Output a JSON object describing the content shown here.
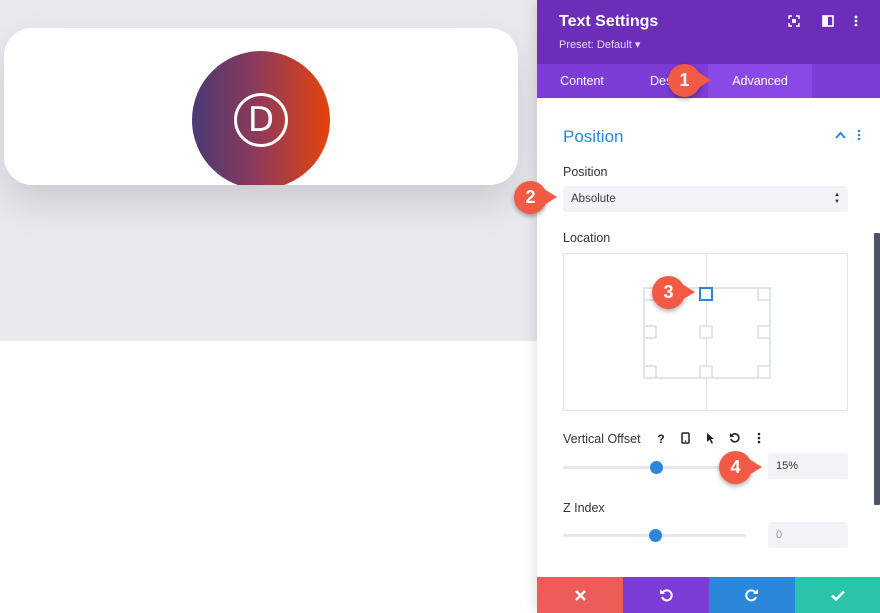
{
  "canvas": {
    "logo_letter": "D"
  },
  "panel": {
    "title": "Text Settings",
    "preset": "Preset: Default ▾",
    "header_icons": [
      "expand-icon",
      "split-view-icon",
      "more-icon"
    ],
    "tabs": [
      {
        "label": "Content"
      },
      {
        "label": "Des"
      },
      {
        "label": "Advanced",
        "active": true
      }
    ],
    "section": {
      "title": "Position",
      "position_label": "Position",
      "position_value": "Absolute",
      "location_label": "Location",
      "vertical_offset_label": "Vertical Offset",
      "vertical_offset_value": "15%",
      "vertical_offset_fraction": 0.5,
      "z_index_label": "Z Index",
      "z_index_placeholder": "0",
      "z_index_fraction": 0.5
    },
    "footer_colors": {
      "cancel": "#ee5b5b",
      "undo": "#7d3cd6",
      "redo": "#2b87da",
      "save": "#29c4a9"
    }
  },
  "callouts": [
    "1",
    "2",
    "3",
    "4"
  ],
  "colors": {
    "header": "#6c2eb9",
    "tabs": "#7d3cd6",
    "accent": "#2b87da",
    "callout": "#f25a45"
  }
}
